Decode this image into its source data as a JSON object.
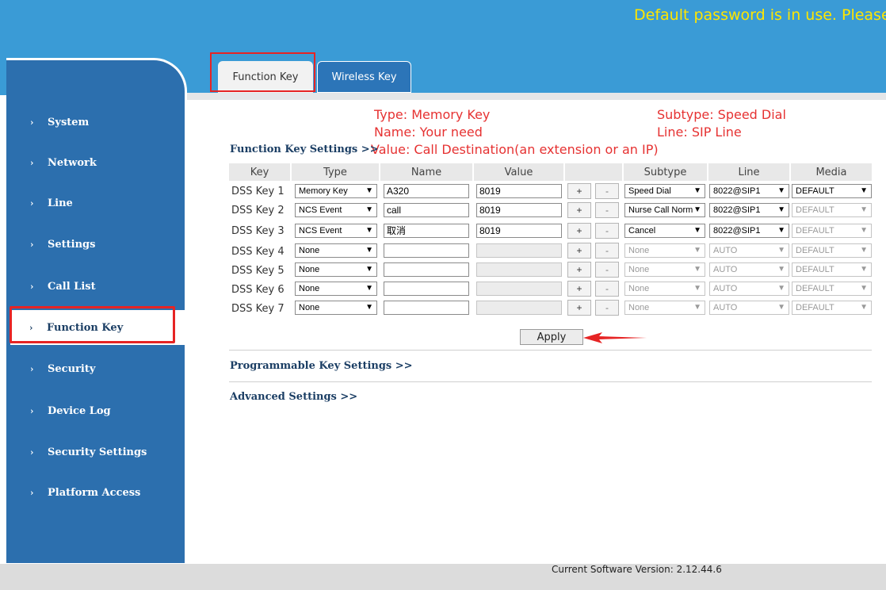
{
  "banner": {
    "warning": "Default password is in use. Please change it."
  },
  "tabs": [
    {
      "label": "Function Key"
    },
    {
      "label": "Wireless Key"
    }
  ],
  "sidebar": {
    "items": [
      {
        "label": "System"
      },
      {
        "label": "Network"
      },
      {
        "label": "Line"
      },
      {
        "label": "Settings"
      },
      {
        "label": "Call List"
      },
      {
        "label": "Function Key"
      },
      {
        "label": "Security"
      },
      {
        "label": "Device Log"
      },
      {
        "label": "Security Settings"
      },
      {
        "label": "Platform Access"
      }
    ],
    "active": "Function Key"
  },
  "annotations": {
    "type": "Type: Memory Key",
    "name": "Name: Your need",
    "value": "Value: Call Destination(an extension or an IP)",
    "subtype": "Subtype: Speed Dial",
    "line": "Line: SIP Line"
  },
  "sections": {
    "function_key": "Function Key Settings >>",
    "programmable": "Programmable Key Settings >>",
    "advanced": "Advanced Settings >>"
  },
  "table": {
    "headers": {
      "key": "Key",
      "type": "Type",
      "name": "Name",
      "value": "Value",
      "subtype": "Subtype",
      "line": "Line",
      "media": "Media"
    },
    "plus": "+",
    "minus": "-",
    "rows": [
      {
        "key": "DSS Key 1",
        "type": "Memory Key",
        "name": "A320",
        "value": "8019",
        "subtype": "Speed Dial",
        "line": "8022@SIP1",
        "media": "DEFAULT"
      },
      {
        "key": "DSS Key 2",
        "type": "NCS Event",
        "name": "call",
        "value": "8019",
        "subtype": "Nurse Call Norm",
        "line": "8022@SIP1",
        "media": "DEFAULT"
      },
      {
        "key": "DSS Key 3",
        "type": "NCS Event",
        "name": "取消",
        "value": "8019",
        "subtype": "Cancel",
        "line": "8022@SIP1",
        "media": "DEFAULT"
      },
      {
        "key": "DSS Key 4",
        "type": "None",
        "name": "",
        "value": "",
        "subtype": "None",
        "line": "AUTO",
        "media": "DEFAULT"
      },
      {
        "key": "DSS Key 5",
        "type": "None",
        "name": "",
        "value": "",
        "subtype": "None",
        "line": "AUTO",
        "media": "DEFAULT"
      },
      {
        "key": "DSS Key 6",
        "type": "None",
        "name": "",
        "value": "",
        "subtype": "None",
        "line": "AUTO",
        "media": "DEFAULT"
      },
      {
        "key": "DSS Key 7",
        "type": "None",
        "name": "",
        "value": "",
        "subtype": "None",
        "line": "AUTO",
        "media": "DEFAULT"
      }
    ]
  },
  "apply_label": "Apply",
  "footer": {
    "version": "Current Software Version: 2.12.44.6"
  },
  "colors": {
    "topbar": "#3a9bd6",
    "sidebar": "#2c6fae",
    "warning": "#ffe600",
    "highlight": "#e62424",
    "annotation": "#e63232"
  },
  "icons": {
    "nav": "chevron-right-icon",
    "dropdown": "chevron-down-icon",
    "arrow": "red-arrow-icon"
  }
}
